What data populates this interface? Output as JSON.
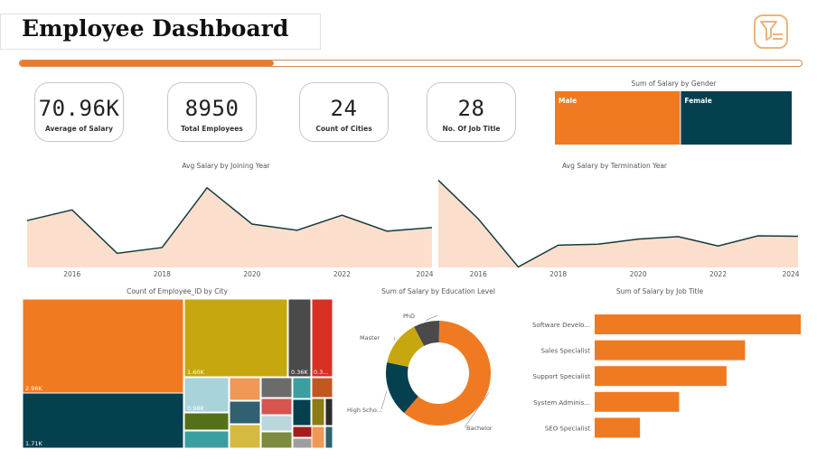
{
  "header": {
    "title": "Employee Dashboard",
    "logo_icon": "filter-list-icon",
    "progress": 0.325,
    "accent": "#f07a22"
  },
  "kpis": [
    {
      "value": "70.96K",
      "label": "Average of Salary"
    },
    {
      "value": "8950",
      "label": "Total Employees"
    },
    {
      "value": "24",
      "label": "Count of Cities"
    },
    {
      "value": "28",
      "label": "No. Of Job Title"
    }
  ],
  "chart_data": [
    {
      "id": "gender",
      "type": "bar",
      "title": "Sum of Salary by Gender",
      "categories": [
        "Male",
        "Female"
      ],
      "shares": [
        0.53,
        0.47
      ],
      "colors": [
        "#f07a22",
        "#05404f"
      ]
    },
    {
      "id": "joining",
      "type": "area",
      "title": "Avg Salary by Joining Year",
      "x": [
        2015,
        2016,
        2017,
        2018,
        2019,
        2020,
        2021,
        2022,
        2023,
        2024
      ],
      "y": [
        70.6,
        73.0,
        63.2,
        64.5,
        78.0,
        69.8,
        68.4,
        71.8,
        68.2,
        69.0
      ],
      "xticks": [
        "2016",
        "2018",
        "2020",
        "2022",
        "2024"
      ],
      "xlim": [
        2015,
        2024
      ],
      "ylim": [
        60,
        80
      ],
      "line_color": "#163b3f",
      "fill_color": "#fbdfcc"
    },
    {
      "id": "termination",
      "type": "area",
      "title": "Avg Salary by Termination Year",
      "x": [
        2015,
        2016,
        2017,
        2018,
        2019,
        2020,
        2021,
        2022,
        2023,
        2024
      ],
      "y": [
        84.5,
        69.2,
        50.2,
        58.8,
        59.2,
        61.2,
        62.2,
        58.5,
        62.5,
        62.3
      ],
      "xticks": [
        "2016",
        "2018",
        "2020",
        "2022",
        "2024"
      ],
      "xlim": [
        2015,
        2024
      ],
      "ylim": [
        50,
        85
      ],
      "line_color": "#163b3f",
      "fill_color": "#fbdfcc"
    },
    {
      "id": "city",
      "type": "treemap",
      "title": "Count of Employee_ID by City",
      "labels": [
        "2.96K",
        "1.71K",
        "1.60K",
        "0.98K",
        "0.36K",
        "0.3..."
      ],
      "colors": [
        "#f07a22",
        "#05404f",
        "#c7a70f",
        "#a8d3da",
        "#4a4a4a",
        "#d93024",
        "#f09856",
        "#2f6170",
        "#6b6b6b",
        "#56701a",
        "#d9534f",
        "#b9d7dd",
        "#c2571f",
        "#d5b940",
        "#7c8b3c",
        "#3b9ea1",
        "#a61c1c",
        "#8b7d16",
        "#9e9e9e",
        "#2b2b2b"
      ]
    },
    {
      "id": "education",
      "type": "pie",
      "title": "Sum of Salary by Education Level",
      "categories": [
        "Bachelor",
        "High Scho...",
        "Master",
        "PhD"
      ],
      "values": [
        0.61,
        0.17,
        0.14,
        0.08
      ],
      "colors": [
        "#f07a22",
        "#05404f",
        "#c7a70f",
        "#4a4a4a"
      ]
    },
    {
      "id": "jobtitle",
      "type": "bar",
      "title": "Sum of Salary by Job Title",
      "categories": [
        "Software Develo...",
        "Sales Specialist",
        "Support Specialist",
        "System Adminis...",
        "SEO Specialist"
      ],
      "values": [
        1.0,
        0.73,
        0.64,
        0.41,
        0.22
      ],
      "color": "#f07a22"
    }
  ]
}
